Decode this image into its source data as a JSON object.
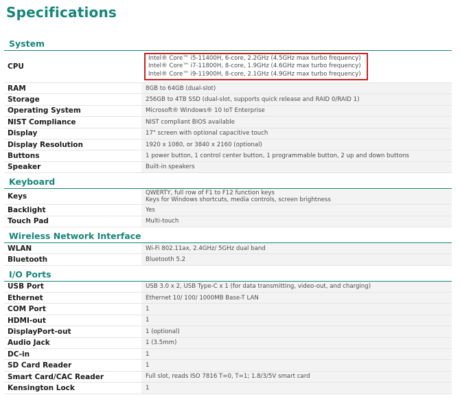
{
  "title": "Specifications",
  "sections": [
    {
      "name": "System",
      "rows": [
        {
          "label": "CPU",
          "values": [
            "Intel® Core™ i5-11400H, 6-core, 2.2GHz (4.5GHz max turbo frequency)",
            "Intel® Core™ i7-11800H, 8-core, 1.9GHz (4.6GHz max turbo frequency)",
            "Intel® Core™ i9-11900H, 8-core, 2.1GHz (4.9GHz max turbo frequency)"
          ]
        },
        {
          "label": "RAM",
          "values": [
            "8GB to 64GB (dual-slot)"
          ]
        },
        {
          "label": "Storage",
          "values": [
            "256GB to 4TB SSD (dual-slot, supports quick release and RAID 0/RAID 1)"
          ]
        },
        {
          "label": "Operating System",
          "values": [
            "Microsoft® Windows® 10 IoT Enterprise"
          ]
        },
        {
          "label": "NIST Compliance",
          "values": [
            "NIST compliant BIOS available"
          ]
        },
        {
          "label": "Display",
          "values": [
            "17\" screen with optional capacitive touch"
          ]
        },
        {
          "label": "Display Resolution",
          "values": [
            "1920 x 1080, or 3840 x 2160 (optional)"
          ]
        },
        {
          "label": "Buttons",
          "values": [
            "1 power button, 1 control center button, 1 programmable button, 2 up and down buttons"
          ]
        },
        {
          "label": "Speaker",
          "values": [
            "Built-in speakers"
          ]
        }
      ]
    },
    {
      "name": "Keyboard",
      "rows": [
        {
          "label": "Keys",
          "values": [
            "QWERTY, full row of F1 to F12 function keys",
            "Keys for Windows shortcuts, media controls, screen brightness"
          ]
        },
        {
          "label": "Backlight",
          "values": [
            "Yes"
          ]
        },
        {
          "label": "Touch Pad",
          "values": [
            "Multi-touch"
          ]
        }
      ]
    },
    {
      "name": "Wireless Network Interface",
      "rows": [
        {
          "label": "WLAN",
          "values": [
            "Wi-Fi 802.11ax, 2.4GHz/ 5GHz dual band"
          ]
        },
        {
          "label": "Bluetooth",
          "values": [
            "Bluetooth 5.2"
          ]
        }
      ]
    },
    {
      "name": "I/O Ports",
      "rows": [
        {
          "label": "USB Port",
          "values": [
            "USB 3.0 x 2, USB Type-C x 1 (for data transmitting, video-out, and charging)"
          ]
        },
        {
          "label": "Ethernet",
          "values": [
            "Ethernet 10/ 100/ 1000MB Base-T LAN"
          ]
        },
        {
          "label": "COM Port",
          "values": [
            "1"
          ]
        },
        {
          "label": "HDMI-out",
          "values": [
            "1"
          ]
        },
        {
          "label": "DisplayPort-out",
          "values": [
            "1 (optional)"
          ]
        },
        {
          "label": "Audio Jack",
          "values": [
            "1 (3.5mm)"
          ]
        },
        {
          "label": "DC-in",
          "values": [
            "1"
          ]
        },
        {
          "label": "SD Card Reader",
          "values": [
            "1"
          ]
        },
        {
          "label": "Smart Card/CAC Reader",
          "values": [
            "Full slot, reads ISO 7816 T=0, T=1; 1.8/3/5V smart card"
          ]
        },
        {
          "label": "Kensington Lock",
          "values": [
            "1"
          ]
        }
      ]
    }
  ]
}
